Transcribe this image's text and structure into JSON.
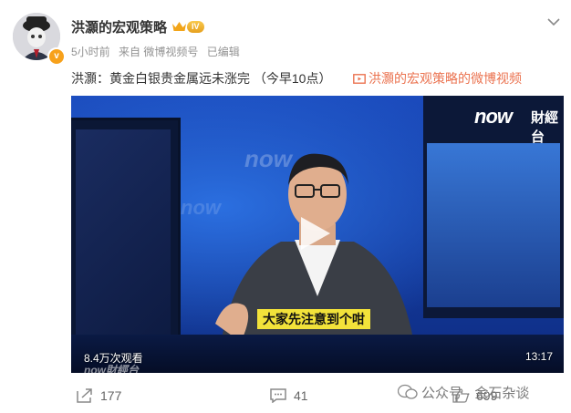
{
  "author": {
    "name": "洪灝的宏观策略",
    "level_badge": "IV",
    "verify_badge": "v"
  },
  "meta": {
    "time": "5小时前",
    "source": "来自 微博视频号",
    "edited": "已编辑"
  },
  "post": {
    "text": "洪灝：黄金白银贵金属远未涨完 （今早10点）",
    "video_link": "洪灝的宏观策略的微博视频"
  },
  "video": {
    "channel_logo_now": "now",
    "channel_logo_cn": "財經台",
    "subtitle": "大家先注意到个咁",
    "views": "8.4万次观看",
    "duration": "13:17",
    "bg_now_text": "now",
    "bottom_text": "now財經台"
  },
  "actions": {
    "repost_count": "177",
    "comment_count": "41",
    "like_count": "699"
  },
  "watermark": "公众号 · 金石杂谈",
  "colors": {
    "accent": "#eb7350",
    "badge": "#f7a11b",
    "subtitle_bg": "#f2e23a"
  }
}
